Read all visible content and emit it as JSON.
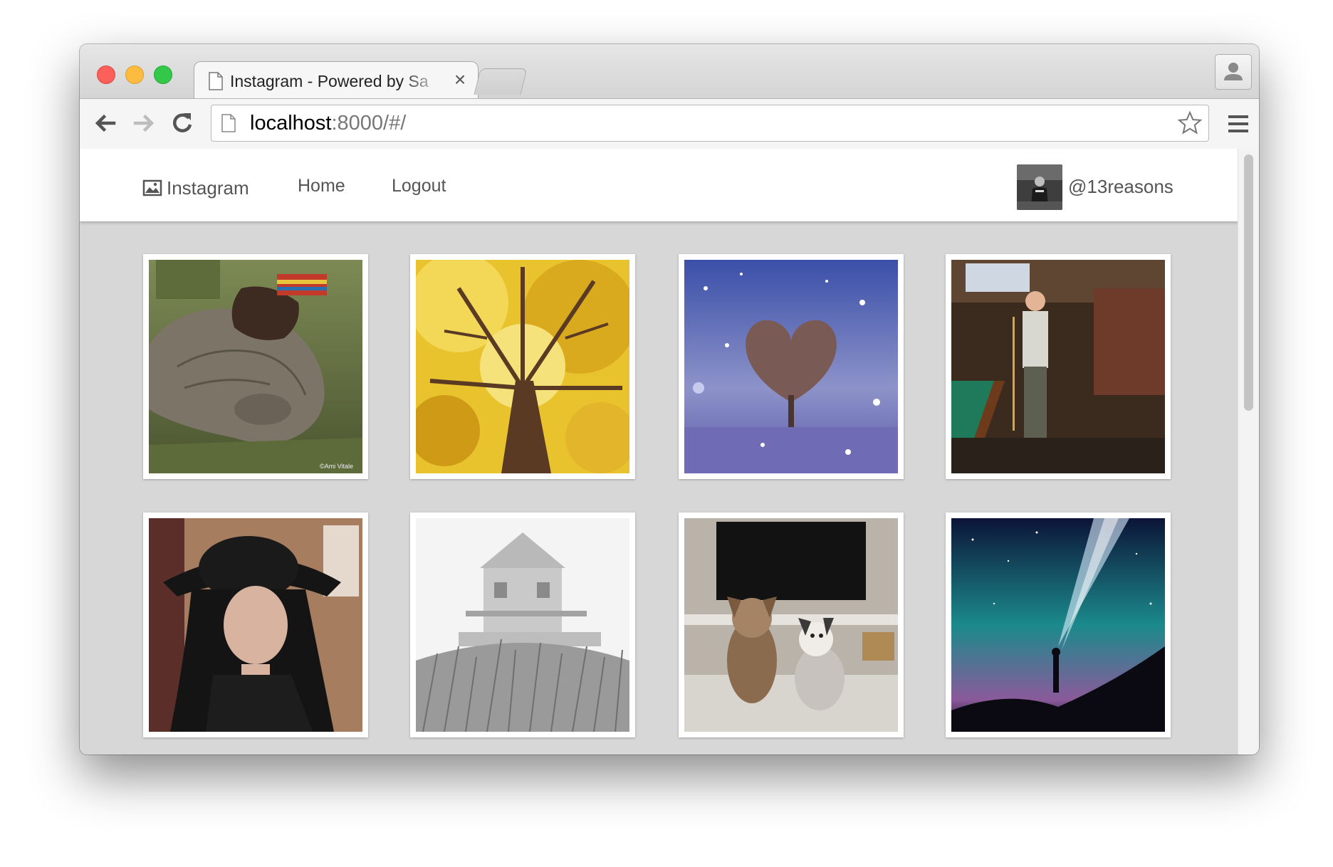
{
  "browser": {
    "tab_title": "Instagram - Powered by Sa",
    "tab_close": "×",
    "url_host": "localhost",
    "url_rest": ":8000/#/"
  },
  "app": {
    "brand": "Instagram",
    "nav": {
      "home": "Home",
      "logout": "Logout"
    },
    "username": "@13reasons"
  },
  "photos": [
    {
      "subject": "baby rhino with beaded hand",
      "watermark": "©Ami Vitale"
    },
    {
      "subject": "yellow tree from below"
    },
    {
      "subject": "heart-shaped tree in snow"
    },
    {
      "subject": "man with pool cue"
    },
    {
      "subject": "woman in bowler hat"
    },
    {
      "subject": "foggy house and grass"
    },
    {
      "subject": "two puppies"
    },
    {
      "subject": "person with light beam under stars"
    }
  ]
}
